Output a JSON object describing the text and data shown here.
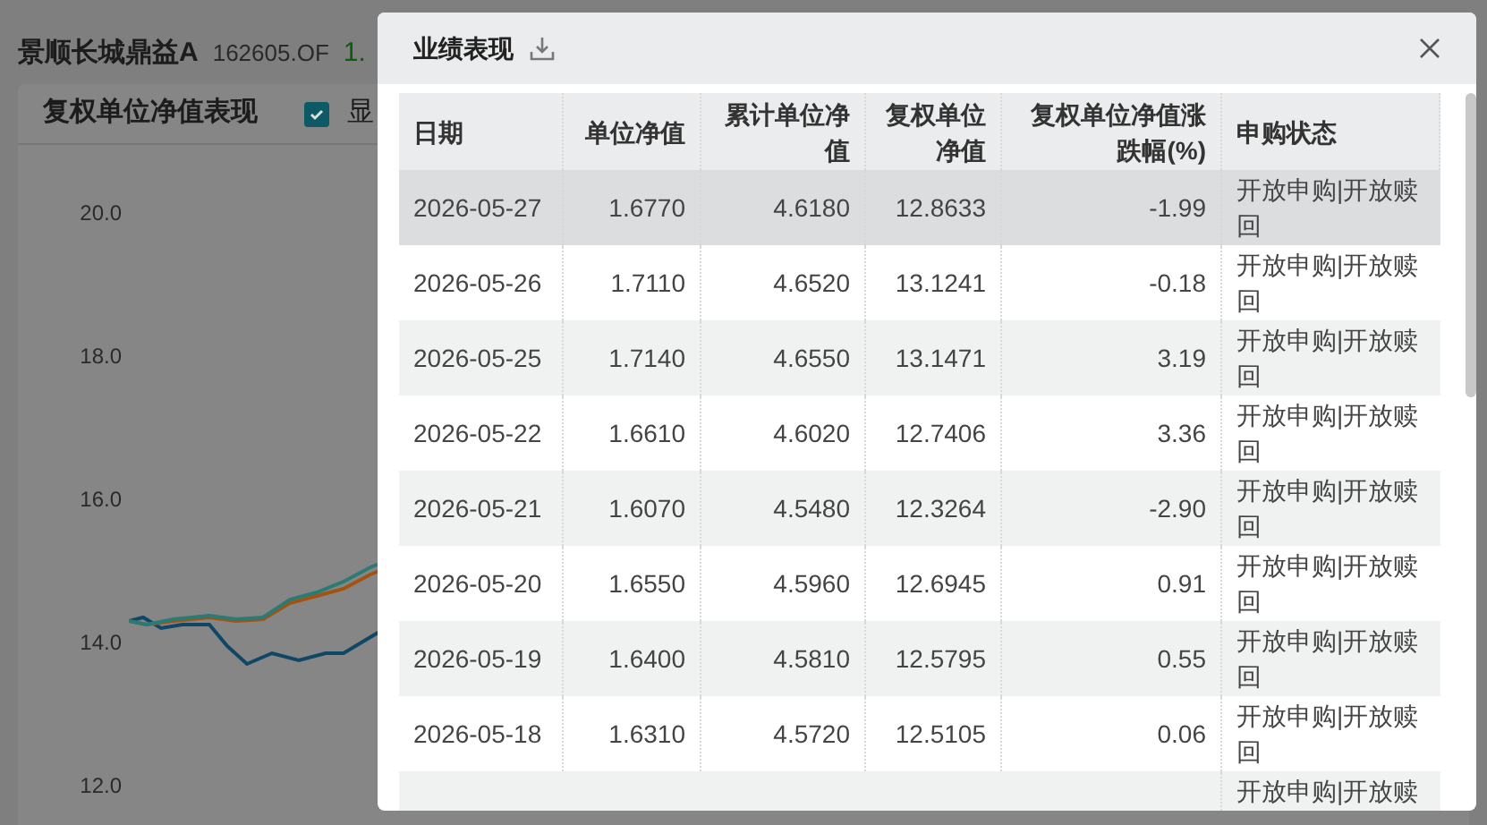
{
  "page": {
    "fund_name": "景顺长城鼎益A",
    "fund_code": "162605.OF",
    "nav_value": "1.",
    "chart_panel": {
      "title": "复权单位净值表现",
      "checkbox": {
        "label": "显",
        "checked": true
      },
      "y_labels": [
        "20.0",
        "18.0",
        "16.0",
        "14.0",
        "12.0"
      ]
    }
  },
  "dialog": {
    "title": "业绩表现",
    "columns": [
      "日期",
      "单位净值",
      "累计单位净值",
      "复权单位净值",
      "复权单位净值涨跌幅(%)",
      "申购状态"
    ],
    "rows": [
      {
        "date": "2026-05-27",
        "nav": "1.6770",
        "acc_nav": "4.6180",
        "adj_nav": "12.8633",
        "change": "-1.99",
        "status": "开放申购|开放赎回",
        "highlighted": true
      },
      {
        "date": "2026-05-26",
        "nav": "1.7110",
        "acc_nav": "4.6520",
        "adj_nav": "13.1241",
        "change": "-0.18",
        "status": "开放申购|开放赎回",
        "highlighted": false
      },
      {
        "date": "2026-05-25",
        "nav": "1.7140",
        "acc_nav": "4.6550",
        "adj_nav": "13.1471",
        "change": "3.19",
        "status": "开放申购|开放赎回",
        "highlighted": false
      },
      {
        "date": "2026-05-22",
        "nav": "1.6610",
        "acc_nav": "4.6020",
        "adj_nav": "12.7406",
        "change": "3.36",
        "status": "开放申购|开放赎回",
        "highlighted": false
      },
      {
        "date": "2026-05-21",
        "nav": "1.6070",
        "acc_nav": "4.5480",
        "adj_nav": "12.3264",
        "change": "-2.90",
        "status": "开放申购|开放赎回",
        "highlighted": false
      },
      {
        "date": "2026-05-20",
        "nav": "1.6550",
        "acc_nav": "4.5960",
        "adj_nav": "12.6945",
        "change": "0.91",
        "status": "开放申购|开放赎回",
        "highlighted": false
      },
      {
        "date": "2026-05-19",
        "nav": "1.6400",
        "acc_nav": "4.5810",
        "adj_nav": "12.5795",
        "change": "0.55",
        "status": "开放申购|开放赎回",
        "highlighted": false
      },
      {
        "date": "2026-05-18",
        "nav": "1.6310",
        "acc_nav": "4.5720",
        "adj_nav": "12.5105",
        "change": "0.06",
        "status": "开放申购|开放赎回",
        "highlighted": false
      }
    ],
    "partial_row": {
      "status": "开放申购|开放赎"
    }
  }
}
